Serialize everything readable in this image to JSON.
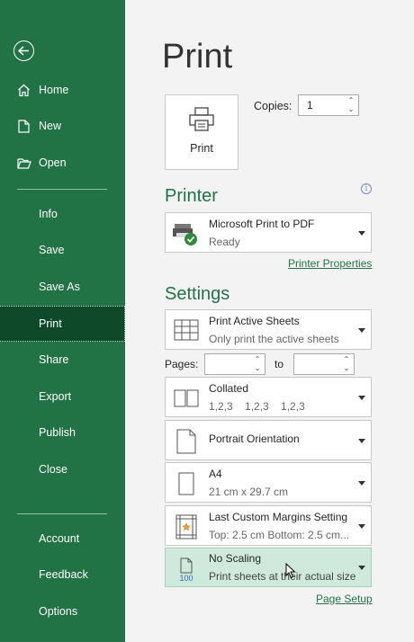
{
  "sidebar": {
    "items": [
      {
        "label": "Home"
      },
      {
        "label": "New"
      },
      {
        "label": "Open"
      },
      {
        "label": "Info"
      },
      {
        "label": "Save"
      },
      {
        "label": "Save As"
      },
      {
        "label": "Print"
      },
      {
        "label": "Share"
      },
      {
        "label": "Export"
      },
      {
        "label": "Publish"
      },
      {
        "label": "Close"
      },
      {
        "label": "Account"
      },
      {
        "label": "Feedback"
      },
      {
        "label": "Options"
      }
    ],
    "active_item": "Print",
    "background": "#217346",
    "active_background": "#0e4a2a"
  },
  "main": {
    "title": "Print",
    "print_button": {
      "label": "Print"
    },
    "copies": {
      "label": "Copies:",
      "value": "1"
    },
    "printer": {
      "section_title": "Printer",
      "name": "Microsoft Print to PDF",
      "status": "Ready",
      "properties_link": "Printer Properties"
    },
    "settings": {
      "section_title": "Settings",
      "print_what": {
        "title": "Print Active Sheets",
        "subtitle": "Only print the active sheets"
      },
      "pages": {
        "label": "Pages:",
        "from": "",
        "to_label": "to",
        "to": ""
      },
      "collation": {
        "title": "Collated",
        "subtitle": "1,2,3    1,2,3    1,2,3"
      },
      "orientation": {
        "title": "Portrait Orientation"
      },
      "paper": {
        "title": "A4",
        "subtitle": "21 cm x 29.7 cm"
      },
      "margins": {
        "title": "Last Custom Margins Setting",
        "subtitle": "Top: 2.5 cm Bottom: 2.5 cm..."
      },
      "scaling": {
        "title": "No Scaling",
        "subtitle": "Print sheets at their actual size",
        "icon_text": "100"
      },
      "page_setup_link": "Page Setup"
    },
    "accent_color": "#217346"
  }
}
